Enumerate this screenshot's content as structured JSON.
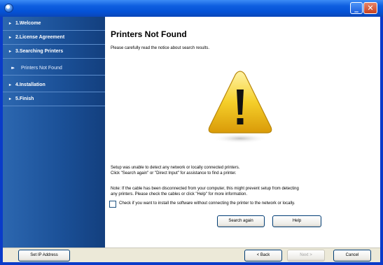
{
  "sidebar": {
    "items": [
      {
        "label": "1.Welcome"
      },
      {
        "label": "2.License Agreement"
      },
      {
        "label": "3.Searching Printers"
      },
      {
        "label": "Printers Not Found"
      },
      {
        "label": "4.Installation"
      },
      {
        "label": "5.Finish"
      }
    ]
  },
  "main": {
    "title": "Printers Not Found",
    "intro": "Please carefully read the notice about search results.",
    "para1_line1": "Setup was unable to detect any network or locally connected printers.",
    "para1_line2": "Click \"Search again\" or \"Direct Input\" for assistance to find a printer.",
    "para2_line1": "Note: If the cable has been disconnected from your computer, this might prevent setup from detecting",
    "para2_line2": "any printers. Please check the cables or click \"Help\" for more information.",
    "checkbox_label": "Check if you want to install the software without connecting the printer to the network or locally.",
    "checkbox_checked": false,
    "search_again": "Search again",
    "help": "Help"
  },
  "bottom": {
    "set_ip": "Set IP Address",
    "back": "< Back",
    "next": "Next >",
    "cancel": "Cancel"
  },
  "icons": {
    "warning": "warning-triangle-icon",
    "minimize": "minimize-icon",
    "close": "close-icon",
    "app": "app-icon"
  }
}
